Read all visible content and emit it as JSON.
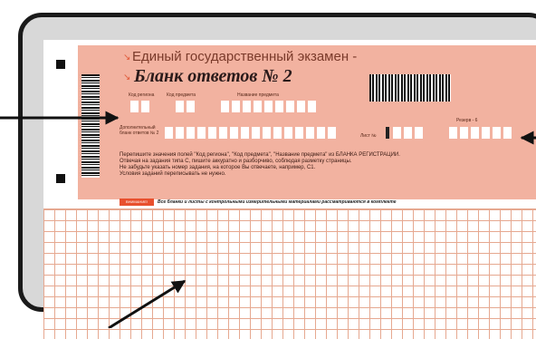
{
  "form": {
    "ege_title": "Единый государственный экзамен -",
    "form_title": "Бланк ответов № 2",
    "field_region_label": "Код региона",
    "field_subject_code_label": "Код предмета",
    "field_subject_name_label": "Название предмета",
    "additional_form_label": "Дополнительный бланк ответов № 2",
    "sheet_label": "Лист №",
    "reserve_label": "Резерв - 6",
    "instructions": [
      "Перепишите значения полей \"Код региона\", \"Код предмета\", \"Название предмета\" из БЛАНКА РЕГИСТРАЦИИ.",
      "Отвечая на задания типа С, пишите аккуратно и разборчиво, соблюдая разметку страницы.",
      "Не забудьте указать номер задания, на которое Вы отвечаете, например, С1.",
      "Условия заданий переписывать не нужно."
    ],
    "attention_label": "ВНИМАНИЕ!",
    "attention_text": "Все бланки и листы с контрольными измерительными материалами рассматриваются в комплекте"
  },
  "colors": {
    "header_pink": "#f2b2a0",
    "grid_line": "#e6a890",
    "accent": "#e8502e",
    "frame": "#1a1a1a"
  }
}
